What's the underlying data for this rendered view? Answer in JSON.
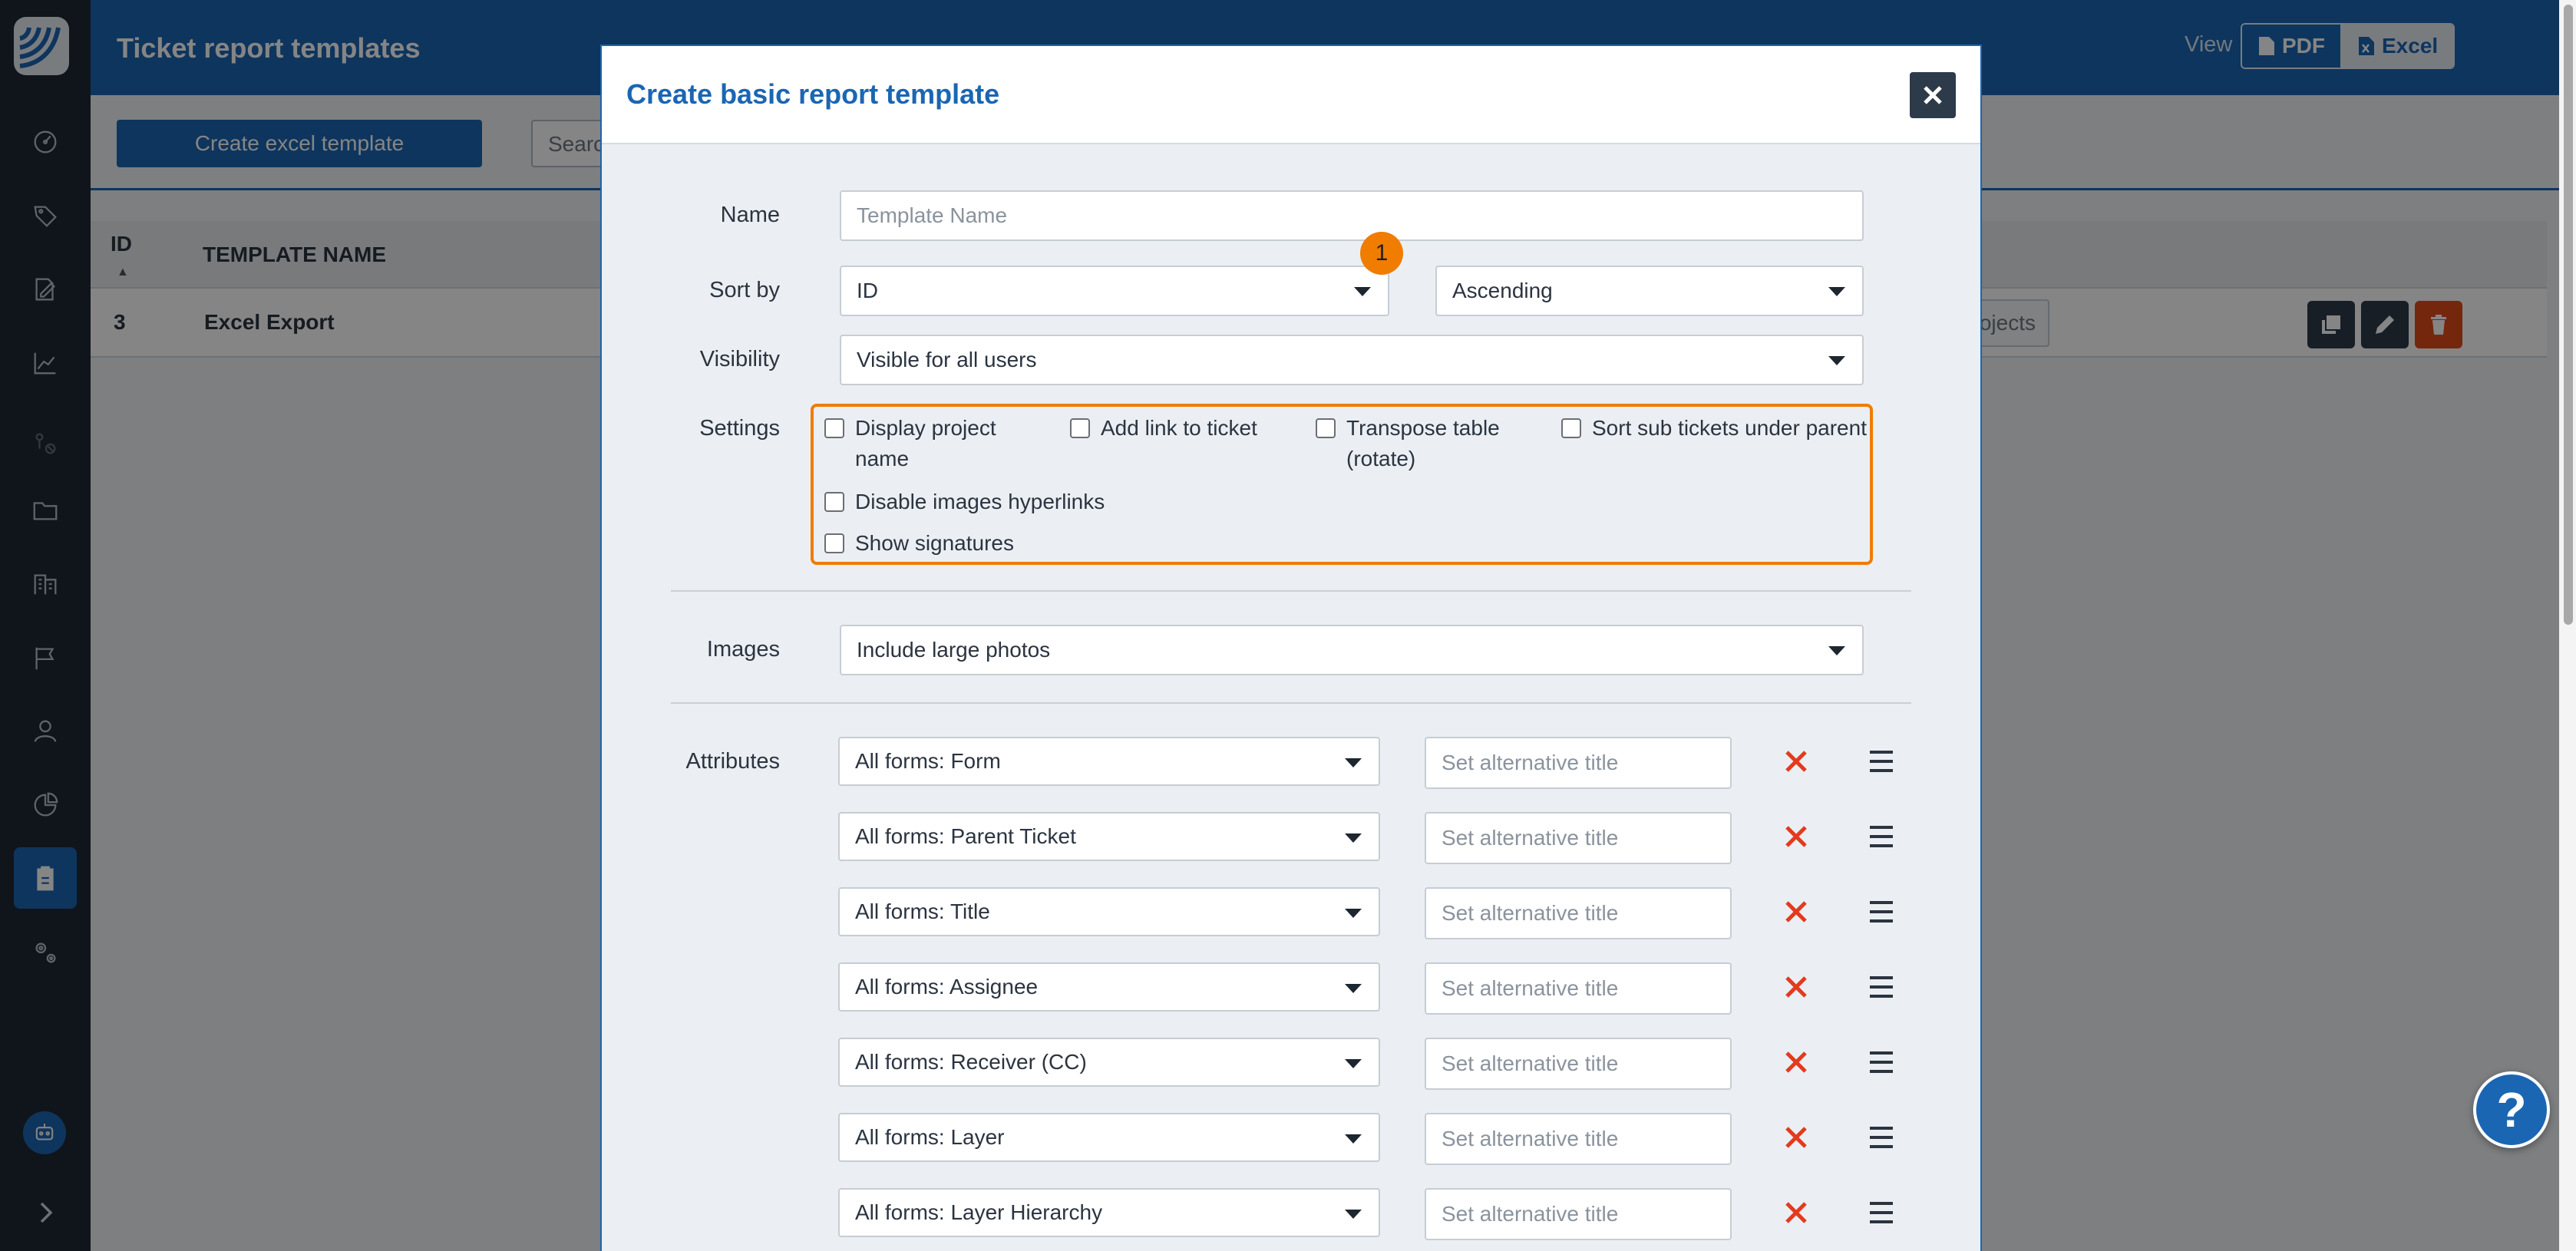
{
  "header": {
    "title": "Ticket report templates",
    "view_label": "View",
    "pdf_label": "PDF",
    "excel_label": "Excel"
  },
  "toolbar": {
    "create_excel_label": "Create excel template",
    "search_placeholder_visible": "Searc"
  },
  "table": {
    "columns": [
      "ID",
      "TEMPLATE NAME"
    ],
    "sort_indicator": "▲",
    "rows": [
      {
        "id": "3",
        "name": "Excel Export",
        "projects_label": "ojects"
      }
    ]
  },
  "modal": {
    "title": "Create basic report template",
    "name_label": "Name",
    "name_placeholder": "Template Name",
    "sortby_label": "Sort by",
    "sortby_value": "ID",
    "order_value": "Ascending",
    "visibility_label": "Visibility",
    "visibility_value": "Visible for all users",
    "settings_label": "Settings",
    "settings": [
      "Display project name",
      "Add link to ticket",
      "Transpose table (rotate)",
      "Sort sub tickets under parent",
      "Disable images hyperlinks",
      "Show signatures"
    ],
    "settings_lines": {
      "display_project_1": "Display project",
      "display_project_2": "name",
      "transpose_1": "Transpose table",
      "transpose_2": "(rotate)"
    },
    "marker": "1",
    "images_label": "Images",
    "images_value": "Include large photos",
    "attributes_label": "Attributes",
    "alt_placeholder": "Set alternative title",
    "attributes": [
      "All forms: Form",
      "All forms: Parent Ticket",
      "All forms: Title",
      "All forms: Assignee",
      "All forms: Receiver (CC)",
      "All forms: Layer",
      "All forms: Layer Hierarchy"
    ]
  },
  "help_label": "?",
  "colors": {
    "brand_blue": "#1b66b3",
    "sidebar": "#1f2934",
    "highlight_orange": "#f07c00",
    "delete_red": "#e14b1c",
    "remove_x": "#e33a1d"
  }
}
